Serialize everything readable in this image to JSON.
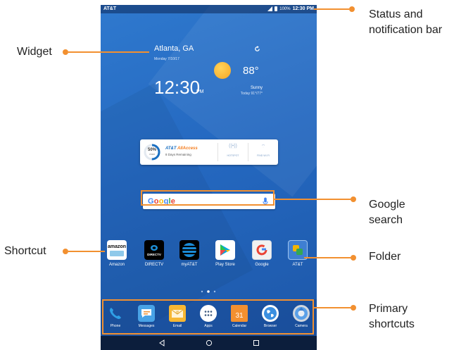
{
  "status_bar": {
    "carrier": "AT&T",
    "battery": "100%",
    "time": "12:30 PM"
  },
  "weather": {
    "city": "Atlanta, GA",
    "date": "Monday 7/10/17",
    "time": "12:30",
    "ampm": "PM",
    "temperature": "88°",
    "condition": "Sunny",
    "range": "Today 91°/77°"
  },
  "allaccess": {
    "percent": "50%",
    "used_label": "USED",
    "used_fraction": 0.5,
    "title_prefix": "AT&T",
    "title_accent": "AllAccess",
    "days_remaining": "8 Days Remaining",
    "hotspot_label": "HOTSPOT",
    "wifi_label": "FIND WI-FI"
  },
  "search": {
    "logo": "Google"
  },
  "apps": [
    {
      "label": "Amazon",
      "icon": "amazon-icon"
    },
    {
      "label": "DIRECTV",
      "icon": "directv-icon"
    },
    {
      "label": "myAT&T",
      "icon": "att-globe-icon"
    },
    {
      "label": "Play Store",
      "icon": "play-store-icon"
    },
    {
      "label": "Google",
      "icon": "google-icon"
    },
    {
      "label": "AT&T",
      "icon": "folder-icon"
    }
  ],
  "amazon_wordmark": "amazon",
  "directv_wordmark": "DIRECTV",
  "calendar_day": "31",
  "dock": [
    {
      "label": "Phone",
      "icon": "phone-icon"
    },
    {
      "label": "Messages",
      "icon": "messages-icon"
    },
    {
      "label": "Email",
      "icon": "email-icon"
    },
    {
      "label": "Apps",
      "icon": "apps-icon"
    },
    {
      "label": "Calendar",
      "icon": "calendar-icon"
    },
    {
      "label": "Browser",
      "icon": "browser-icon"
    },
    {
      "label": "Camera",
      "icon": "camera-icon"
    }
  ],
  "nav": [
    "back-icon",
    "home-icon",
    "recents-icon"
  ],
  "callouts": {
    "status": [
      "Status and",
      "notification bar"
    ],
    "widget": "Widget",
    "search": [
      "Google",
      "search"
    ],
    "shortcut": "Shortcut",
    "folder": "Folder",
    "primary": [
      "Primary",
      "shortcuts"
    ]
  },
  "colors": {
    "accent": "#f29030",
    "wallpaper": "#2468c0",
    "att_blue": "#1a6fc1"
  }
}
